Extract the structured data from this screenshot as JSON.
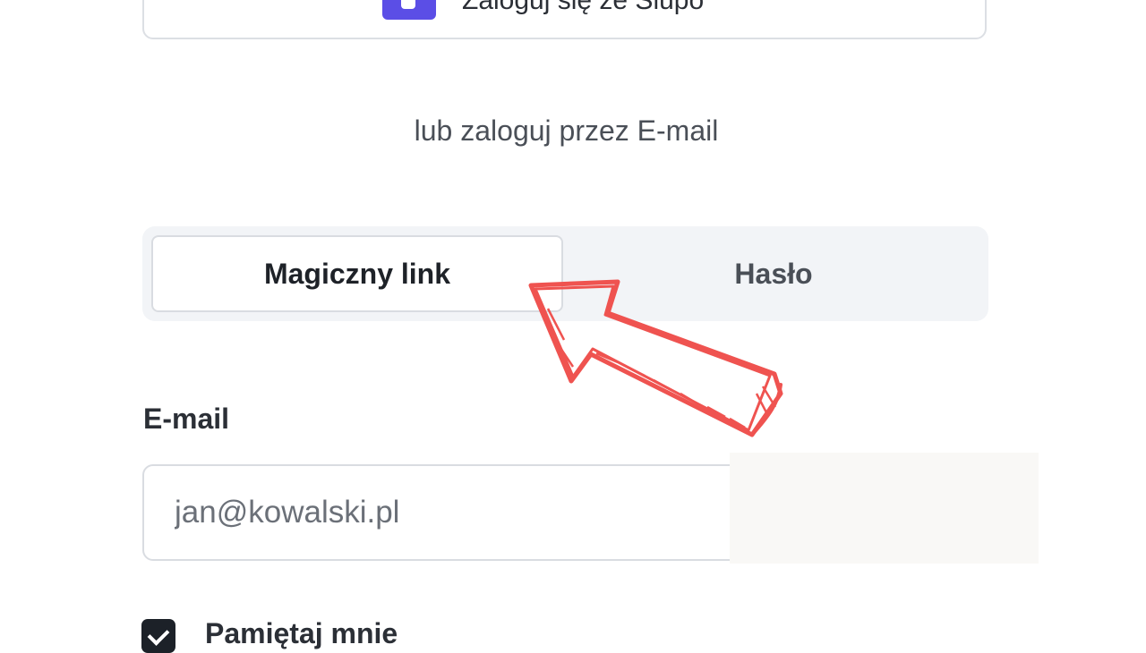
{
  "sso": {
    "label": "Zaloguj się ze Slupo",
    "icon": "brand-logo-icon",
    "icon_color": "#5b4ee6"
  },
  "divider": {
    "text": "lub zaloguj przez E-mail"
  },
  "tabs": [
    {
      "label": "Magiczny link",
      "active": true
    },
    {
      "label": "Hasło",
      "active": false
    }
  ],
  "email": {
    "label": "E-mail",
    "placeholder": "jan@kowalski.pl",
    "value": ""
  },
  "remember": {
    "label": "Pamiętaj mnie",
    "checked": true
  },
  "annotation": {
    "icon": "hand-drawn-arrow-icon",
    "color": "#ef5350"
  }
}
